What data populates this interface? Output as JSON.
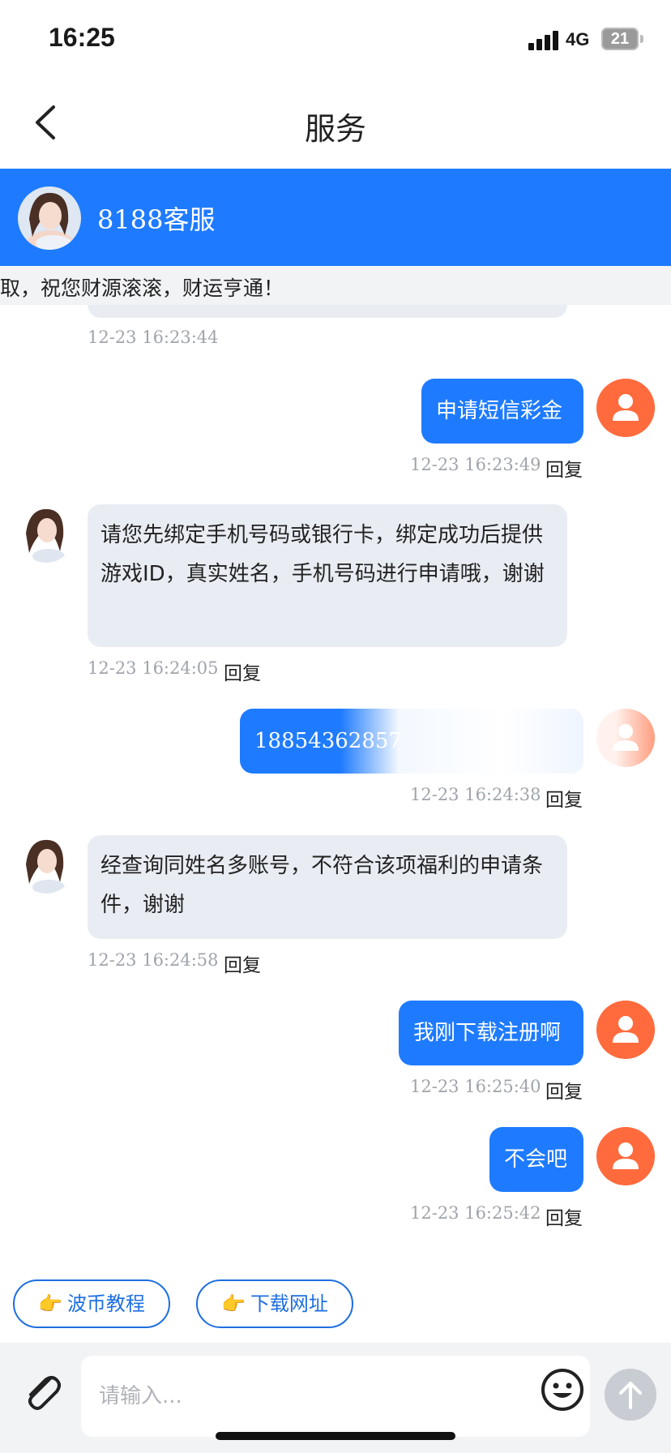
{
  "status": {
    "time": "16:25",
    "network": "4G",
    "battery": "21"
  },
  "nav": {
    "title": "服务"
  },
  "agent": {
    "name": "8188客服"
  },
  "notice": {
    "text": "取，祝您财源滚滚，财运亨通！"
  },
  "messages": [
    {
      "from": "agent",
      "text": "",
      "time": "12-23 16:23:44"
    },
    {
      "from": "user",
      "text": "申请短信彩金",
      "time": "12-23 16:23:49",
      "reply": "回复"
    },
    {
      "from": "agent",
      "text": "请您先绑定手机号码或银行卡，绑定成功后提供游戏ID，真实姓名，手机号码进行申请哦，谢谢",
      "time": "12-23 16:24:05",
      "reply": "回复"
    },
    {
      "from": "user",
      "text": "18854362857",
      "time": "12-23 16:24:38",
      "reply": "回复"
    },
    {
      "from": "agent",
      "text": "经查询同姓名多账号，不符合该项福利的申请条件，谢谢",
      "time": "12-23 16:24:58",
      "reply": "回复"
    },
    {
      "from": "user",
      "text": "我刚下载注册啊",
      "time": "12-23 16:25:40",
      "reply": "回复"
    },
    {
      "from": "user",
      "text": "不会吧",
      "time": "12-23 16:25:42",
      "reply": "回复"
    }
  ],
  "quick_actions": [
    {
      "label": "波币教程"
    },
    {
      "label": "下载网址"
    }
  ],
  "input": {
    "placeholder": "请输入..."
  },
  "colors": {
    "primary": "#1e7bff",
    "user_avatar": "#ff6b3d",
    "agent_bubble": "#e9edf3"
  }
}
